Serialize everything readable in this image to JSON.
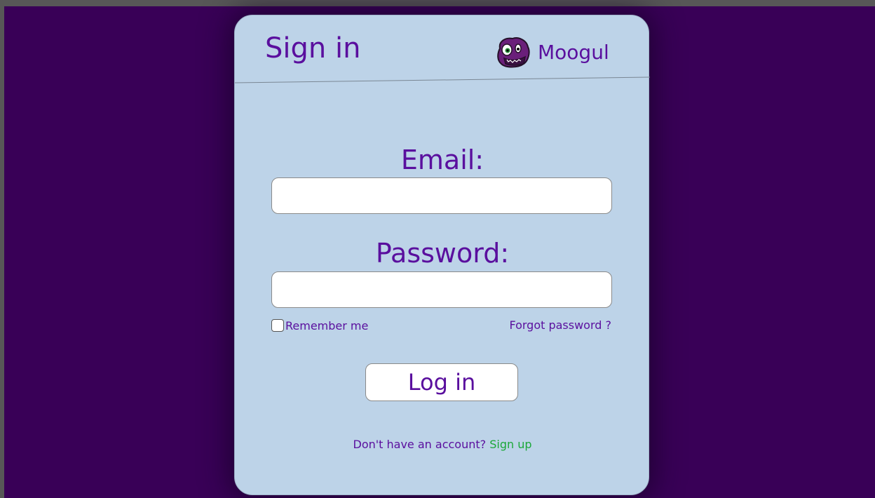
{
  "header": {
    "title": "Sign in",
    "brand_name": "Moogul",
    "logo_icon": "moogul-mascot-icon"
  },
  "form": {
    "email_label": "Email:",
    "email_value": "",
    "password_label": "Password:",
    "password_value": "",
    "remember_label": "Remember me",
    "remember_checked": false,
    "forgot_label": "Forgot password ?",
    "login_label": "Log in"
  },
  "footer": {
    "signup_prompt": "Don't have an account?",
    "signup_link": "Sign up"
  },
  "colors": {
    "page_background": "#390057",
    "card_background": "#bdd3e8",
    "text_purple": "#5a0f9e",
    "link_green": "#1ca83a"
  }
}
